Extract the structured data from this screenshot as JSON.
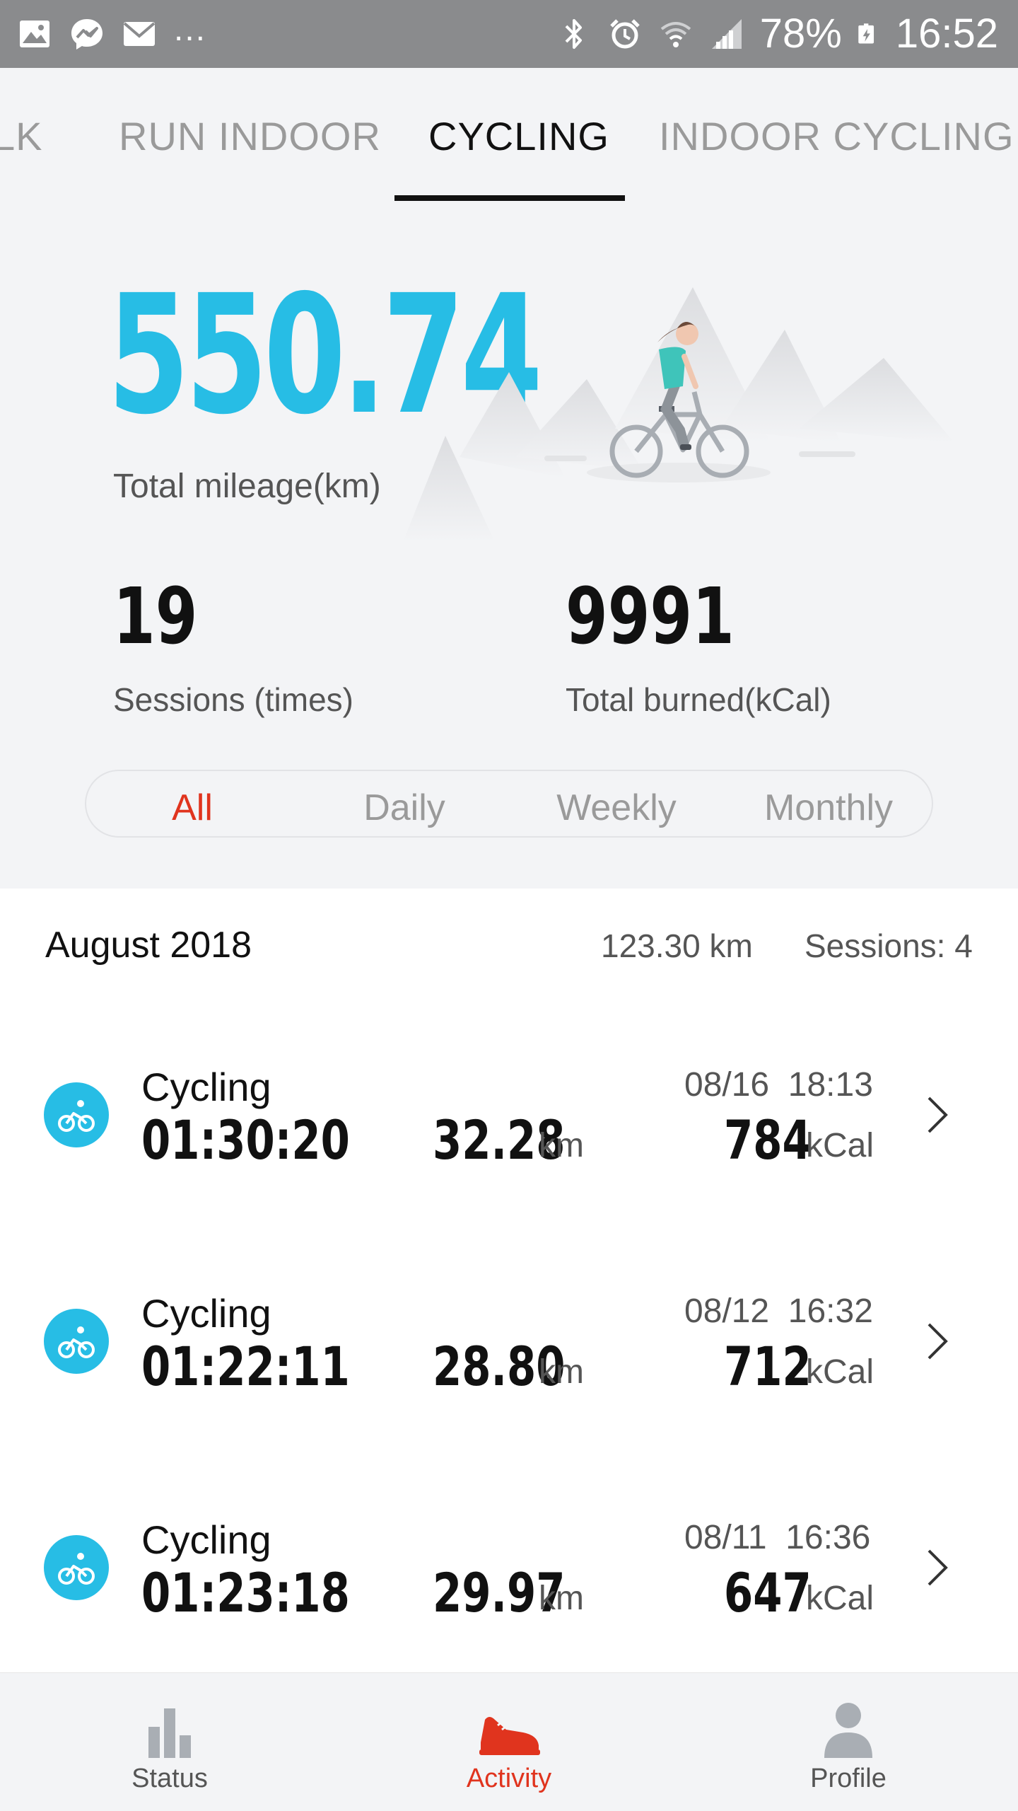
{
  "status_bar": {
    "battery": "78%",
    "time": "16:52",
    "left_icons": [
      "gallery-icon",
      "messenger-icon",
      "mail-icon"
    ],
    "more": "...",
    "right_icons": [
      "bluetooth-icon",
      "alarm-icon",
      "wifi-icon",
      "signal-icon",
      "battery-charging-icon"
    ]
  },
  "tabs": [
    {
      "label": "LK",
      "active": false
    },
    {
      "label": "RUN INDOOR",
      "active": false
    },
    {
      "label": "CYCLING",
      "active": true
    },
    {
      "label": "INDOOR CYCLING",
      "active": false
    }
  ],
  "summary": {
    "mileage_value": "550.74",
    "mileage_label": "Total mileage(km)",
    "sessions_value": "19",
    "sessions_label": "Sessions (times)",
    "burned_value": "9991",
    "burned_label": "Total burned(kCal)"
  },
  "period_filter": {
    "options": [
      "All",
      "Daily",
      "Weekly",
      "Monthly"
    ],
    "selected": "All"
  },
  "month": {
    "title": "August 2018",
    "distance": "123.30 km",
    "sessions": "Sessions: 4"
  },
  "sessions": [
    {
      "title": "Cycling",
      "date": "08/16  18:13",
      "duration": "01:30:20",
      "distance": "32.28",
      "distance_unit": "km",
      "calories": "784",
      "calories_unit": "kCal"
    },
    {
      "title": "Cycling",
      "date": "08/12  16:32",
      "duration": "01:22:11",
      "distance": "28.80",
      "distance_unit": "km",
      "calories": "712",
      "calories_unit": "kCal"
    },
    {
      "title": "Cycling",
      "date": "08/11  16:36",
      "duration": "01:23:18",
      "distance": "29.97",
      "distance_unit": "km",
      "calories": "647",
      "calories_unit": "kCal"
    }
  ],
  "bottom_nav": [
    {
      "label": "Status",
      "icon": "bar-chart-icon",
      "active": false
    },
    {
      "label": "Activity",
      "icon": "shoe-icon",
      "active": true
    },
    {
      "label": "Profile",
      "icon": "person-icon",
      "active": false
    }
  ],
  "colors": {
    "accent_blue": "#27bde5",
    "accent_red": "#e0341e",
    "status_bar": "#8a8b8d",
    "background": "#f3f4f6"
  }
}
